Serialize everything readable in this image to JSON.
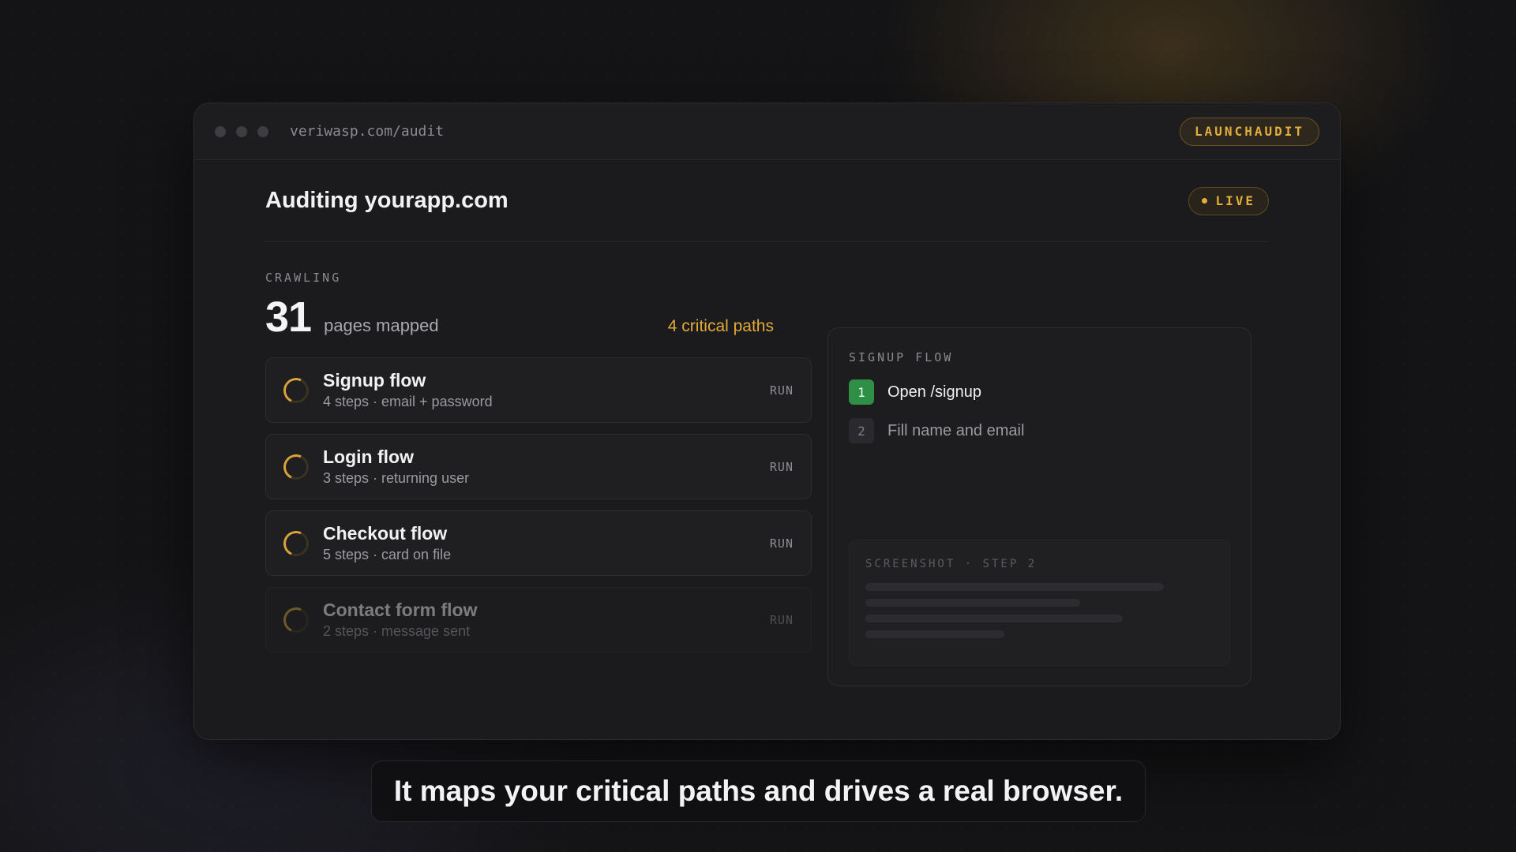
{
  "window": {
    "url": "veriwasp.com/audit",
    "launch_label": "LAUNCHAUDIT"
  },
  "header": {
    "title": "Auditing yourapp.com",
    "live_label": "LIVE"
  },
  "crawl": {
    "section_label": "CRAWLING",
    "pages_count": "31",
    "pages_label": "pages mapped",
    "critical_label": "4 critical paths"
  },
  "flows": [
    {
      "name": "Signup flow",
      "meta": "4 steps · email + password",
      "action": "RUN"
    },
    {
      "name": "Login flow",
      "meta": "3 steps · returning user",
      "action": "RUN"
    },
    {
      "name": "Checkout flow",
      "meta": "5 steps · card on file",
      "action": "RUN"
    },
    {
      "name": "Contact form flow",
      "meta": "2 steps · message sent",
      "action": "RUN"
    }
  ],
  "panel": {
    "title": "SIGNUP FLOW",
    "steps": [
      {
        "num": "1",
        "label": "Open /signup",
        "state": "active"
      },
      {
        "num": "2",
        "label": "Fill name and email",
        "state": "pending"
      }
    ],
    "screenshot_label": "SCREENSHOT · STEP 2"
  },
  "caption": "It maps your critical paths and drives a real browser.",
  "colors": {
    "accent": "#e3ae3c",
    "step_active": "#2f8f46",
    "background": "#141416"
  }
}
